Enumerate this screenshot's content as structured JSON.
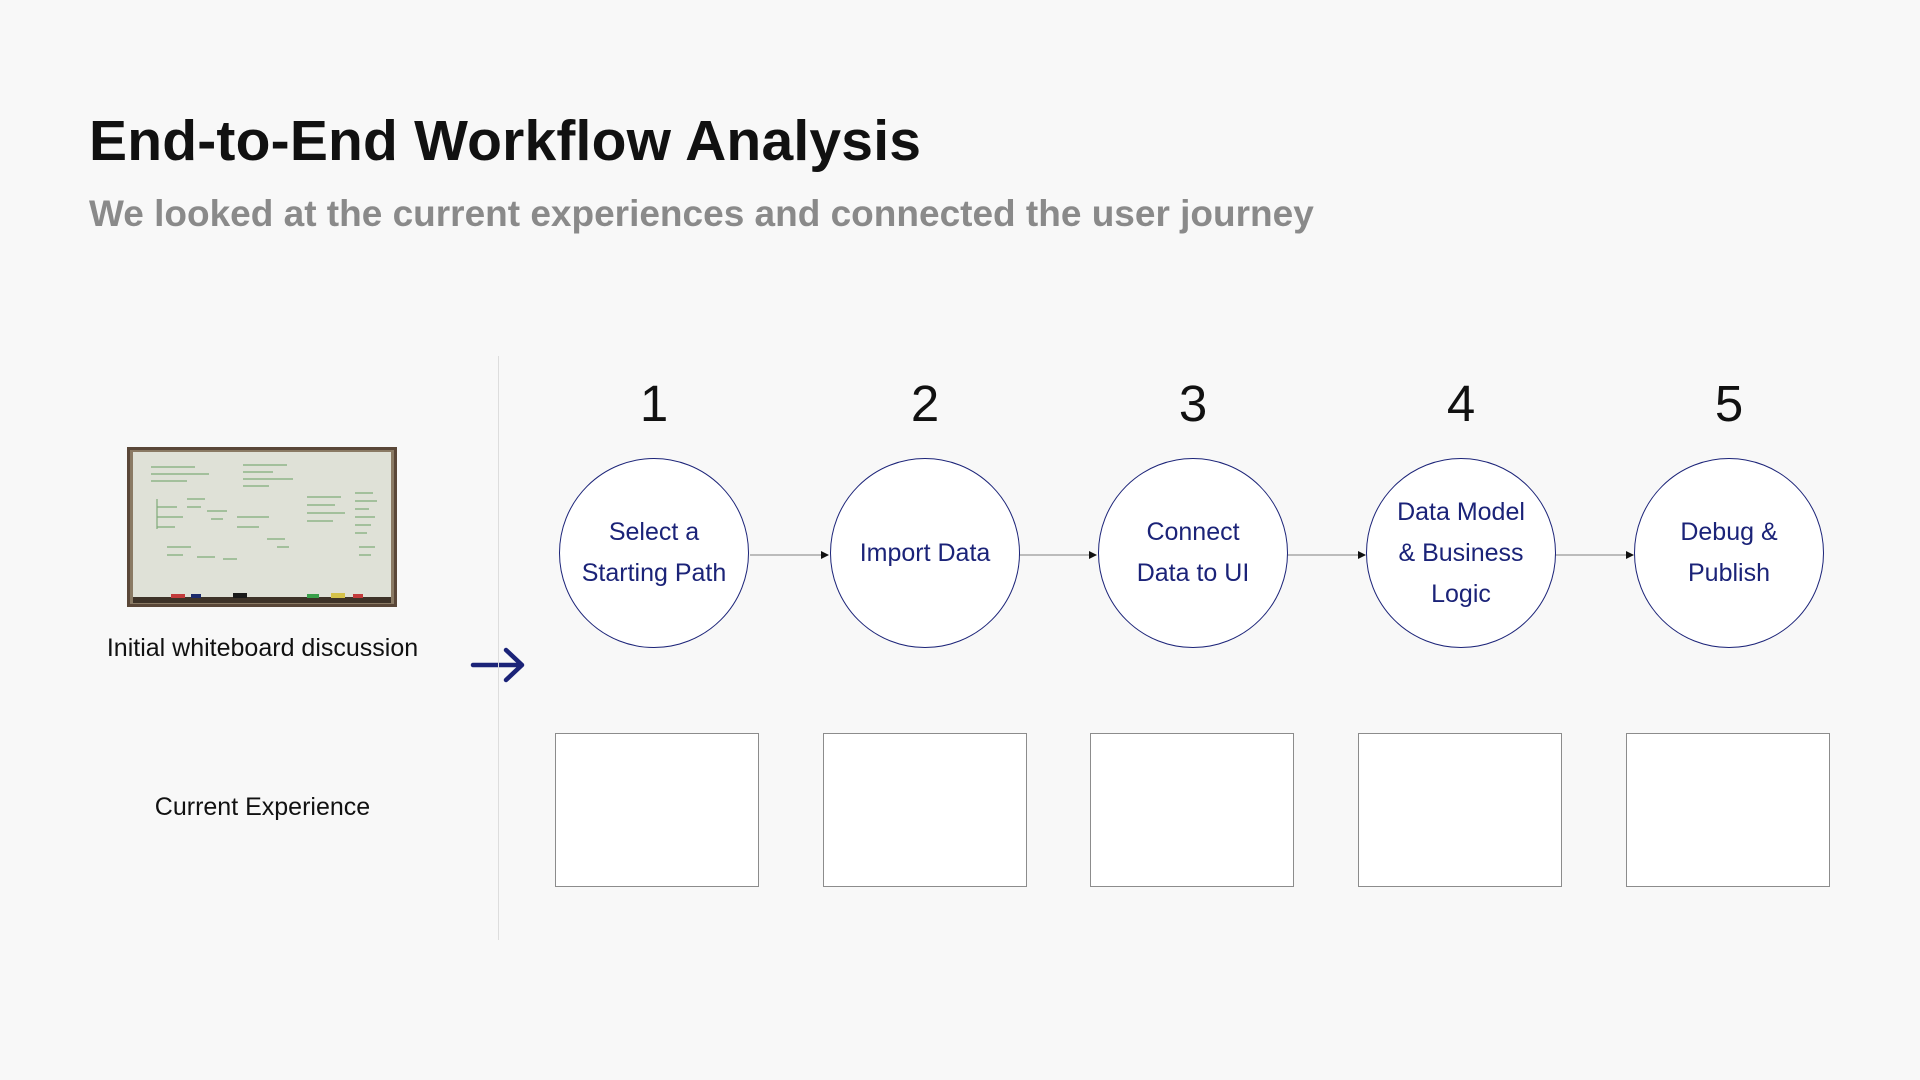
{
  "header": {
    "title": "End-to-End Workflow Analysis",
    "subtitle": "We looked at the current experiences and connected the user journey"
  },
  "left_panel": {
    "whiteboard_caption": "Initial whiteboard discussion",
    "current_experience_label": "Current Experience"
  },
  "steps": [
    {
      "number": "1",
      "label": "Select a Starting Path"
    },
    {
      "number": "2",
      "label": "Import Data"
    },
    {
      "number": "3",
      "label": "Connect Data to UI"
    },
    {
      "number": "4",
      "label": "Data Model & Business Logic"
    },
    {
      "number": "5",
      "label": "Debug & Publish"
    }
  ],
  "colors": {
    "accent": "#1b2378",
    "title": "#111111",
    "subtitle": "#8a8a8a",
    "background": "#f8f8f8"
  }
}
